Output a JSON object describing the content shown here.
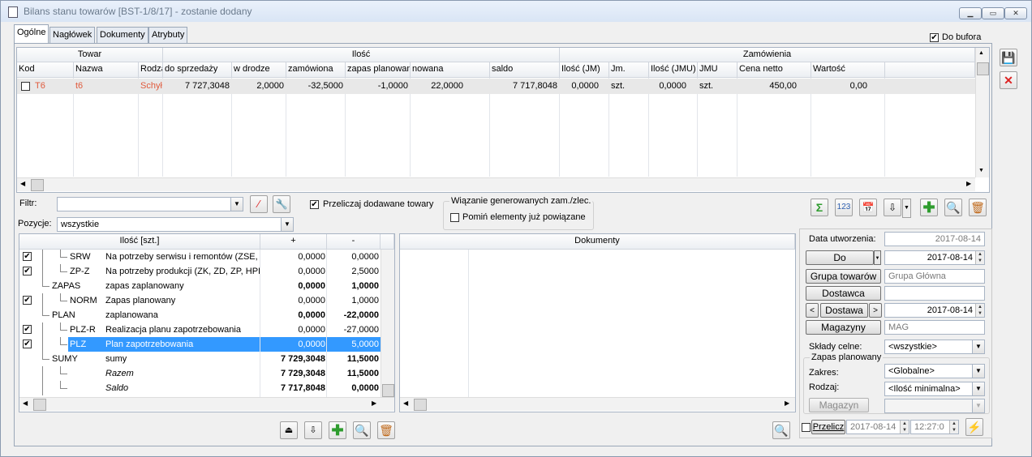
{
  "window": {
    "title": "Bilans stanu towarów [BST-1/8/17] - zostanie dodany"
  },
  "tabs": [
    "Ogólne",
    "Nagłówek",
    "Dokumenty",
    "Atrybuty"
  ],
  "do_bufora": {
    "label": "Do bufora",
    "checked": true
  },
  "top_grid": {
    "group_headers": {
      "towar": "Towar",
      "ilosc": "Ilość",
      "zamowienia": "Zamówienia"
    },
    "columns": [
      "Kod",
      "Nazwa",
      "Rodza",
      "do sprzedaży",
      "w drodze",
      "zamówiona",
      "zapas planowan",
      "nowana",
      "saldo",
      "Ilość (JM)",
      "Jm.",
      "Ilość (JMU)",
      "JMU",
      "Cena netto",
      "Wartość"
    ],
    "row": {
      "kod": "T6",
      "nazwa": "t6",
      "rodzaj": "Schyłk",
      "do_sprzedazy": "7 727,3048",
      "w_drodze": "2,0000",
      "zamowiona": "-32,5000",
      "zapas_planowany": "-1,0000",
      "planowana": "22,0000",
      "saldo": "7 717,8048",
      "ilosc_jm": "0,0000",
      "jm": "szt.",
      "ilosc_jmu": "0,0000",
      "jmu": "szt.",
      "cena_netto": "450,00",
      "wartosc": "0,00"
    }
  },
  "filters": {
    "filtr_label": "Filtr:",
    "filtr_value": "",
    "pozycje_label": "Pozycje:",
    "pozycje_value": "wszystkie",
    "przeliczaj_label": "Przeliczaj dodawane towary",
    "przeliczaj_checked": true,
    "wiazanie_group": "Wiązanie generowanych zam./zlec.",
    "pomin_label": "Pomiń elementy już powiązane",
    "pomin_checked": false
  },
  "tree_grid": {
    "headers": {
      "ilosc": "Ilość [szt.]",
      "plus": "+",
      "minus": "-"
    },
    "rows": [
      {
        "code": "SRW",
        "name": "Na potrzeby serwisu i remontów (ZSE, Z",
        "plus": "0,0000",
        "minus": "0,0000",
        "checked": true,
        "bold": false,
        "italic": false,
        "selected": false,
        "indent": 2
      },
      {
        "code": "ZP-Z",
        "name": "Na potrzeby produkcji (ZK, ZD, ZP, HPR",
        "plus": "0,0000",
        "minus": "2,5000",
        "checked": true,
        "bold": false,
        "italic": false,
        "selected": false,
        "indent": 2
      },
      {
        "code": "ZAPAS",
        "name": "zapas zaplanowany",
        "plus": "0,0000",
        "minus": "1,0000",
        "checked": null,
        "bold": true,
        "italic": false,
        "selected": false,
        "indent": 1
      },
      {
        "code": "NORM",
        "name": "Zapas planowany",
        "plus": "0,0000",
        "minus": "1,0000",
        "checked": true,
        "bold": false,
        "italic": false,
        "selected": false,
        "indent": 2
      },
      {
        "code": "PLAN",
        "name": "zaplanowana",
        "plus": "0,0000",
        "minus": "-22,0000",
        "checked": null,
        "bold": true,
        "italic": false,
        "selected": false,
        "indent": 1
      },
      {
        "code": "PLZ-R",
        "name": "Realizacja planu zapotrzebowania",
        "plus": "0,0000",
        "minus": "-27,0000",
        "checked": true,
        "bold": false,
        "italic": false,
        "selected": false,
        "indent": 2
      },
      {
        "code": "PLZ",
        "name": "Plan zapotrzebowania",
        "plus": "0,0000",
        "minus": "5,0000",
        "checked": true,
        "bold": false,
        "italic": false,
        "selected": true,
        "indent": 2
      },
      {
        "code": "SUMY",
        "name": "sumy",
        "plus": "7 729,3048",
        "minus": "11,5000",
        "checked": null,
        "bold": true,
        "italic": false,
        "selected": false,
        "indent": 1
      },
      {
        "code": "",
        "name": "Razem",
        "plus": "7 729,3048",
        "minus": "11,5000",
        "checked": null,
        "bold": true,
        "italic": true,
        "selected": false,
        "indent": 2
      },
      {
        "code": "",
        "name": "Saldo",
        "plus": "7 717,8048",
        "minus": "0,0000",
        "checked": null,
        "bold": true,
        "italic": true,
        "selected": false,
        "indent": 2
      }
    ]
  },
  "documents": {
    "header": "Dokumenty"
  },
  "right_panel": {
    "data_utworzenia_label": "Data utworzenia:",
    "data_utworzenia_value": "2017-08-14",
    "do_button": "Do",
    "do_value": "2017-08-14",
    "grupa_button": "Grupa towarów",
    "grupa_value": "Grupa Główna",
    "dostawca_button": "Dostawca",
    "dostawca_value": "",
    "dostawa_button": "Dostawa",
    "dostawa_value": "2017-08-14",
    "magazyny_button": "Magazyny",
    "magazyny_value": "MAG",
    "sklady_label": "Składy celne:",
    "sklady_value": "<wszystkie>",
    "zapas_group": "Zapas planowany",
    "zakres_label": "Zakres:",
    "zakres_value": "<Globalne>",
    "rodzaj_label": "Rodzaj:",
    "rodzaj_value": "<Ilość minimalna>",
    "magazyn_button": "Magazyn",
    "przelicz_label": "Przelicz",
    "przelicz_date": "2017-08-14",
    "przelicz_time": "12:27:0"
  },
  "colors": {
    "selection": "#3399ff",
    "red_text": "#e05a3c",
    "accent_green": "#2e9c2e"
  }
}
